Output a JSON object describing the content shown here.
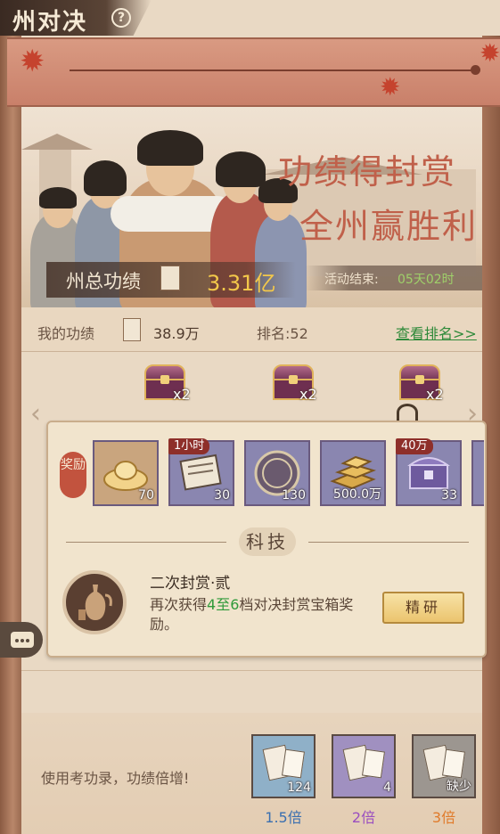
{
  "header": {
    "title": "州对决",
    "help_label": "?"
  },
  "hero": {
    "headline1": "功绩得封赏",
    "headline2": "全州赢胜利",
    "total_label": "州总功绩",
    "total_value": "3.31亿",
    "end_label": "活动结束:",
    "end_value": "05天02时"
  },
  "stats": {
    "my_label": "我的功绩",
    "my_value": "38.9万",
    "rank_label": "排名:52",
    "rank_link": "查看排名>>"
  },
  "chests": [
    {
      "icon": "treasure-chest",
      "count": "x2"
    },
    {
      "icon": "treasure-chest",
      "count": "x2"
    },
    {
      "icon": "treasure-chest",
      "count": "x2"
    }
  ],
  "popup": {
    "reward_tag": "奖励",
    "items": [
      {
        "icon": "gold-ingot",
        "count": "70",
        "badge": ""
      },
      {
        "icon": "scroll",
        "count": "30",
        "badge": "1小时"
      },
      {
        "icon": "duel-coin",
        "count": "130",
        "badge": ""
      },
      {
        "icon": "gold-bars",
        "count": "500.0万",
        "badge": ""
      },
      {
        "icon": "purple-chest",
        "count": "33",
        "badge": "40万"
      }
    ],
    "section_title": "科技",
    "tech_name": "二次封赏·贰",
    "tech_desc_prefix": "再次获得",
    "tech_desc_hl1": "4",
    "tech_desc_mid": "至",
    "tech_desc_hl2": "6",
    "tech_desc_suffix": "档对决封赏宝箱奖励。",
    "button": "精研"
  },
  "bottom": {
    "text": "使用考功录，功绩倍增!",
    "books": [
      {
        "count": "124",
        "multiplier": "1.5倍",
        "color": "#3a6fb0"
      },
      {
        "count": "4",
        "multiplier": "2倍",
        "color": "#9a4fc0"
      },
      {
        "count": "缺少",
        "multiplier": "3倍",
        "color": "#e07a2a"
      }
    ]
  },
  "colors": {
    "accent_red": "#c0604a",
    "gold": "#f3c84a",
    "green": "#2f8a3a"
  }
}
